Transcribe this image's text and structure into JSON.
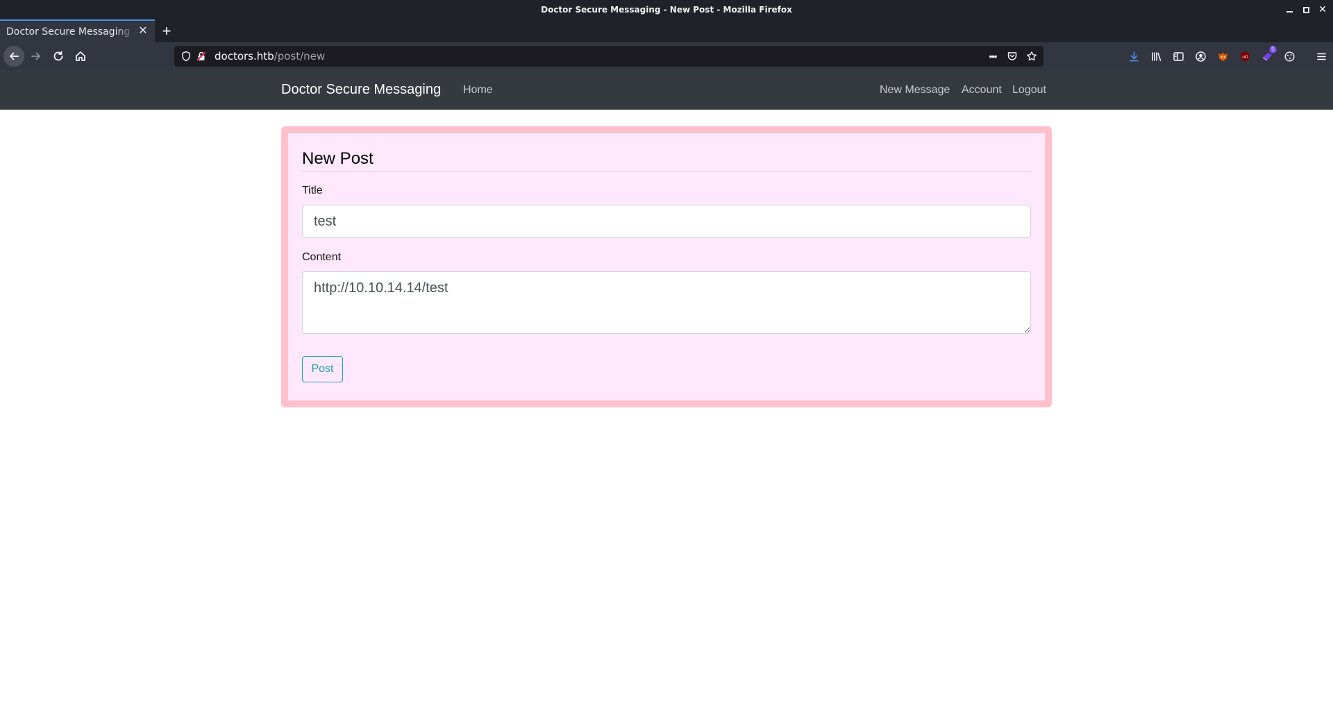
{
  "window": {
    "title": "Doctor Secure Messaging - New Post - Mozilla Firefox"
  },
  "browser": {
    "tab_title": "Doctor Secure Messaging - New Post",
    "close_glyph": "✕",
    "new_tab_glyph": "+",
    "url_host": "doctors.htb",
    "url_path": "/post/new",
    "url_more_glyph": "•••",
    "extension_badge": "5"
  },
  "site": {
    "brand": "Doctor Secure Messaging",
    "nav_left": [
      "Home"
    ],
    "nav_right": [
      "New Message",
      "Account",
      "Logout"
    ]
  },
  "form": {
    "legend": "New Post",
    "title_label": "Title",
    "title_value": "test",
    "content_label": "Content",
    "content_value": "http://10.10.14.14/test",
    "submit_label": "Post"
  },
  "colors": {
    "navbar_bg": "#343a40",
    "card_border": "#ffc0cb",
    "card_bg": "#ffe8fb",
    "button_accent": "#17a2b8",
    "download_icon": "#4b8de6"
  }
}
